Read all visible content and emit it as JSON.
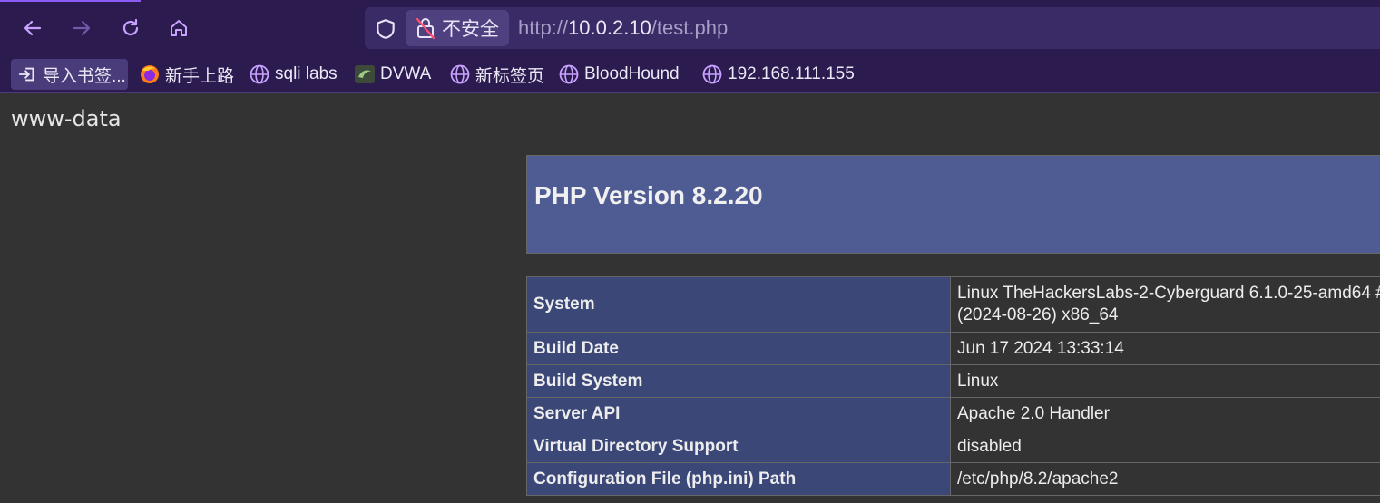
{
  "browser": {
    "url_prefix": "http://",
    "url_host": "10.0.2.10",
    "url_path": "/test.php",
    "security_label": "不安全",
    "accent_color": "#8b5cf6"
  },
  "bookmarks": [
    {
      "label": "导入书签...",
      "icon": "import-icon"
    },
    {
      "label": "新手上路",
      "icon": "firefox-icon"
    },
    {
      "label": "sqli labs",
      "icon": "globe-icon"
    },
    {
      "label": "DVWA",
      "icon": "dvwa-icon"
    },
    {
      "label": "新标签页",
      "icon": "globe-icon"
    },
    {
      "label": "BloodHound",
      "icon": "globe-icon"
    },
    {
      "label": "192.168.111.155",
      "icon": "globe-icon"
    }
  ],
  "page": {
    "whoami": "www-data",
    "php_title": "PHP Version 8.2.20",
    "header_color": "#4f5b93",
    "rows": [
      {
        "key": "System",
        "value_line1": "Linux TheHackersLabs-2-Cyberguard 6.1.0-25-amd64 #",
        "value_line2": "(2024-08-26) x86_64"
      },
      {
        "key": "Build Date",
        "value": "Jun 17 2024 13:33:14"
      },
      {
        "key": "Build System",
        "value": "Linux"
      },
      {
        "key": "Server API",
        "value": "Apache 2.0 Handler"
      },
      {
        "key": "Virtual Directory Support",
        "value": "disabled"
      },
      {
        "key": "Configuration File (php.ini) Path",
        "value": "/etc/php/8.2/apache2"
      }
    ]
  }
}
